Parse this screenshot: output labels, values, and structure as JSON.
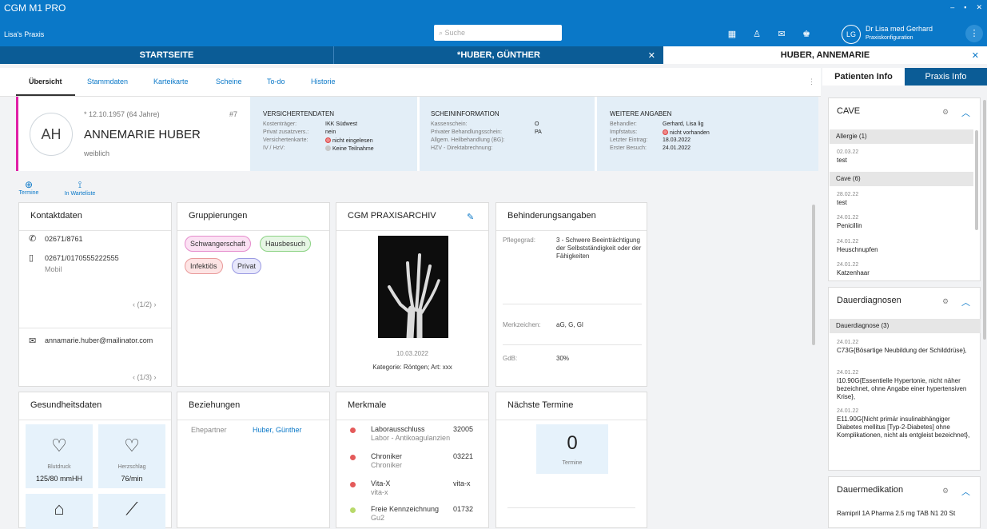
{
  "app": {
    "title": "CGM M1 PRO",
    "practice": "Lisa's Praxis",
    "search_placeholder": "Suche",
    "user_initials": "LG",
    "user_name": "Dr Lisa med Gerhard",
    "user_sub": "Praxiskonfiguration",
    "window_controls": [
      "–",
      "▪",
      "✕"
    ]
  },
  "tabs": [
    {
      "label": "STARTSEITE"
    },
    {
      "label": "*HUBER, GÜNTHER",
      "close": "✕"
    },
    {
      "label": "HUBER, ANNEMARIE",
      "close": "✕"
    }
  ],
  "subnav": [
    "Übersicht",
    "Stammdaten",
    "Karteikarte",
    "Scheine",
    "To-do",
    "Historie"
  ],
  "patient": {
    "initials": "AH",
    "dob": "* 12.10.1957 (64 Jahre)",
    "number": "#7",
    "name": "ANNEMARIE HUBER",
    "gender": "weiblich"
  },
  "versicherten": {
    "title": "VERSICHERTENDATEN",
    "rows": [
      [
        "Kostenträger:",
        "IKK Südwest"
      ],
      [
        "Privat zusatzvers.:",
        "nein"
      ],
      [
        "Versichertenkarte:",
        "nicht eingelesen"
      ],
      [
        "IV / HzV:",
        "Keine Teilnahme"
      ]
    ]
  },
  "schein": {
    "title": "SCHEININFORMATION",
    "rows": [
      [
        "Kassenschein:",
        "O"
      ],
      [
        "Privater Behandlungsschein:",
        "PA"
      ],
      [
        "Allgem. Heilbehandlung (BG):",
        ""
      ],
      [
        "HZV - Direktabrechnung:",
        ""
      ]
    ]
  },
  "weitere": {
    "title": "WEITERE ANGABEN",
    "rows": [
      [
        "Behandler:",
        "Gerhard, Lisa lig"
      ],
      [
        "Impfstatus:",
        "nicht vorhanden"
      ],
      [
        "Letzter Eintrag:",
        "18.03.2022"
      ],
      [
        "Erster Besuch:",
        "24.01.2022"
      ]
    ]
  },
  "quick": {
    "termine": "Termine",
    "warteliste": "In Warteliste"
  },
  "kontakt": {
    "title": "Kontaktdaten",
    "phone": "02671/8761",
    "mobile": "02671/0170555222555",
    "mobile_label": "Mobil",
    "pager1": "(1/2)",
    "email": "annamarie.huber@mailinator.com",
    "pager2": "(1/3)"
  },
  "gruppierungen": {
    "title": "Gruppierungen",
    "tags": [
      "Schwangerschaft",
      "Hausbesuch",
      "Infektiös",
      "Privat"
    ]
  },
  "archiv": {
    "title": "CGM PRAXISARCHIV",
    "date": "10.03.2022",
    "caption": "Kategorie: Röntgen; Art: xxx"
  },
  "behinderung": {
    "title": "Behinderungsangaben",
    "pflegegrad_label": "Pflegegrad:",
    "pflegegrad_value": "3 - Schwere Beeinträchtigung der Selbstständigkeit oder der Fähigkeiten",
    "merkzeichen_label": "Merkzeichen:",
    "merkzeichen_value": "aG, G, Gl",
    "gdb_label": "GdB:",
    "gdb_value": "30%"
  },
  "gesundheit": {
    "title": "Gesundheitsdaten",
    "vitals": [
      {
        "label": "Blutdruck",
        "value": "125/80 mmHH"
      },
      {
        "label": "Herzschlag",
        "value": "76/min"
      }
    ]
  },
  "beziehungen": {
    "title": "Beziehungen",
    "type": "Ehepartner",
    "name": "Huber, Günther"
  },
  "merkmale": {
    "title": "Merkmale",
    "items": [
      {
        "name": "Laborausschluss",
        "sub": "Labor - Antikoagulanzien",
        "code": "32005",
        "color": "#e45a5a"
      },
      {
        "name": "Chroniker",
        "sub": "Chroniker",
        "code": "03221",
        "color": "#e45a5a"
      },
      {
        "name": "Vita-X",
        "sub": "vita-x",
        "code": "vita-x",
        "color": "#e45a5a"
      },
      {
        "name": "Freie Kennzeichnung",
        "sub": "Gu2",
        "code": "01732",
        "color": "#b8d96a"
      }
    ]
  },
  "termine": {
    "title": "Nächste Termine",
    "count": "0",
    "label": "Termine"
  },
  "right": {
    "tab1": "Patienten Info",
    "tab2": "Praxis Info",
    "cave": {
      "title": "CAVE",
      "groups": [
        {
          "label": "Allergie  (1)",
          "entries": [
            {
              "date": "02.03.22",
              "text": "test"
            }
          ]
        },
        {
          "label": "Cave  (6)",
          "entries": [
            {
              "date": "28.02.22",
              "text": "test"
            },
            {
              "date": "24.01.22",
              "text": "Penicillin"
            },
            {
              "date": "24.01.22",
              "text": "Heuschnupfen"
            },
            {
              "date": "24.01.22",
              "text": "Katzenhaar"
            }
          ]
        }
      ]
    },
    "dauerdiagnosen": {
      "title": "Dauerdiagnosen",
      "group": "Dauerdiagnose  (3)",
      "entries": [
        {
          "date": "24.01.22",
          "text": "C73G{Bösartige Neubildung der Schilddrüse},"
        },
        {
          "date": "24.01.22",
          "text": "I10.90G{Essentielle Hypertonie, nicht näher bezeichnet, ohne Angabe einer hypertensiven Krise},"
        },
        {
          "date": "24.01.22",
          "text": "E11.90G{Nicht primär insulinabhängiger Diabetes mellitus [Typ-2-Diabetes] ohne Komplikationen, nicht als entgleist bezeichnet},"
        }
      ]
    },
    "dauermedikation": {
      "title": "Dauermedikation",
      "text": "Ramipril 1A Pharma 2.5 mg TAB N1 20 St"
    }
  }
}
